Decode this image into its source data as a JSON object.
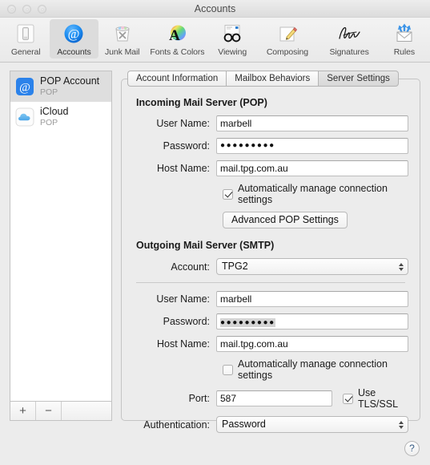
{
  "window": {
    "title": "Accounts"
  },
  "toolbar": {
    "items": [
      {
        "label": "General",
        "icon": "general-icon"
      },
      {
        "label": "Accounts",
        "icon": "accounts-at-icon"
      },
      {
        "label": "Junk Mail",
        "icon": "junk-mail-trash-icon"
      },
      {
        "label": "Fonts & Colors",
        "icon": "fonts-colors-icon"
      },
      {
        "label": "Viewing",
        "icon": "viewing-glasses-icon"
      },
      {
        "label": "Composing",
        "icon": "composing-pencil-icon"
      },
      {
        "label": "Signatures",
        "icon": "signature-icon"
      },
      {
        "label": "Rules",
        "icon": "rules-envelope-icon"
      }
    ],
    "selected_index": 1
  },
  "sidebar": {
    "accounts": [
      {
        "name": "POP Account",
        "type": "POP",
        "icon": "at-sign-icon"
      },
      {
        "name": "iCloud",
        "type": "POP",
        "icon": "cloud-icon"
      }
    ],
    "selected_index": 0,
    "add_label": "+",
    "remove_label": "−"
  },
  "tabs": [
    {
      "label": "Account Information"
    },
    {
      "label": "Mailbox Behaviors"
    },
    {
      "label": "Server Settings"
    }
  ],
  "active_tab_index": 2,
  "incoming": {
    "section_title": "Incoming Mail Server (POP)",
    "user_name_label": "User Name:",
    "user_name_value": "marbell",
    "password_label": "Password:",
    "password_value": "●●●●●●●●●",
    "host_name_label": "Host Name:",
    "host_name_value": "mail.tpg.com.au",
    "auto_manage_label": "Automatically manage connection settings",
    "auto_manage_checked": true,
    "advanced_button_label": "Advanced POP Settings"
  },
  "outgoing": {
    "section_title": "Outgoing Mail Server (SMTP)",
    "account_label": "Account:",
    "account_value": "TPG2",
    "user_name_label": "User Name:",
    "user_name_value": "marbell",
    "password_label": "Password:",
    "password_value": "●●●●●●●●●",
    "host_name_label": "Host Name:",
    "host_name_value": "mail.tpg.com.au",
    "auto_manage_label": "Automatically manage connection settings",
    "auto_manage_checked": false,
    "port_label": "Port:",
    "port_value": "587",
    "tls_label": "Use TLS/SSL",
    "tls_checked": true,
    "authentication_label": "Authentication:",
    "authentication_value": "Password"
  },
  "help": {
    "label": "?"
  },
  "colors": {
    "window_bg": "#ececec",
    "accent_blue": "#1d7ef0",
    "selected_row": "#dedede",
    "field_bg": "#ffffff"
  }
}
